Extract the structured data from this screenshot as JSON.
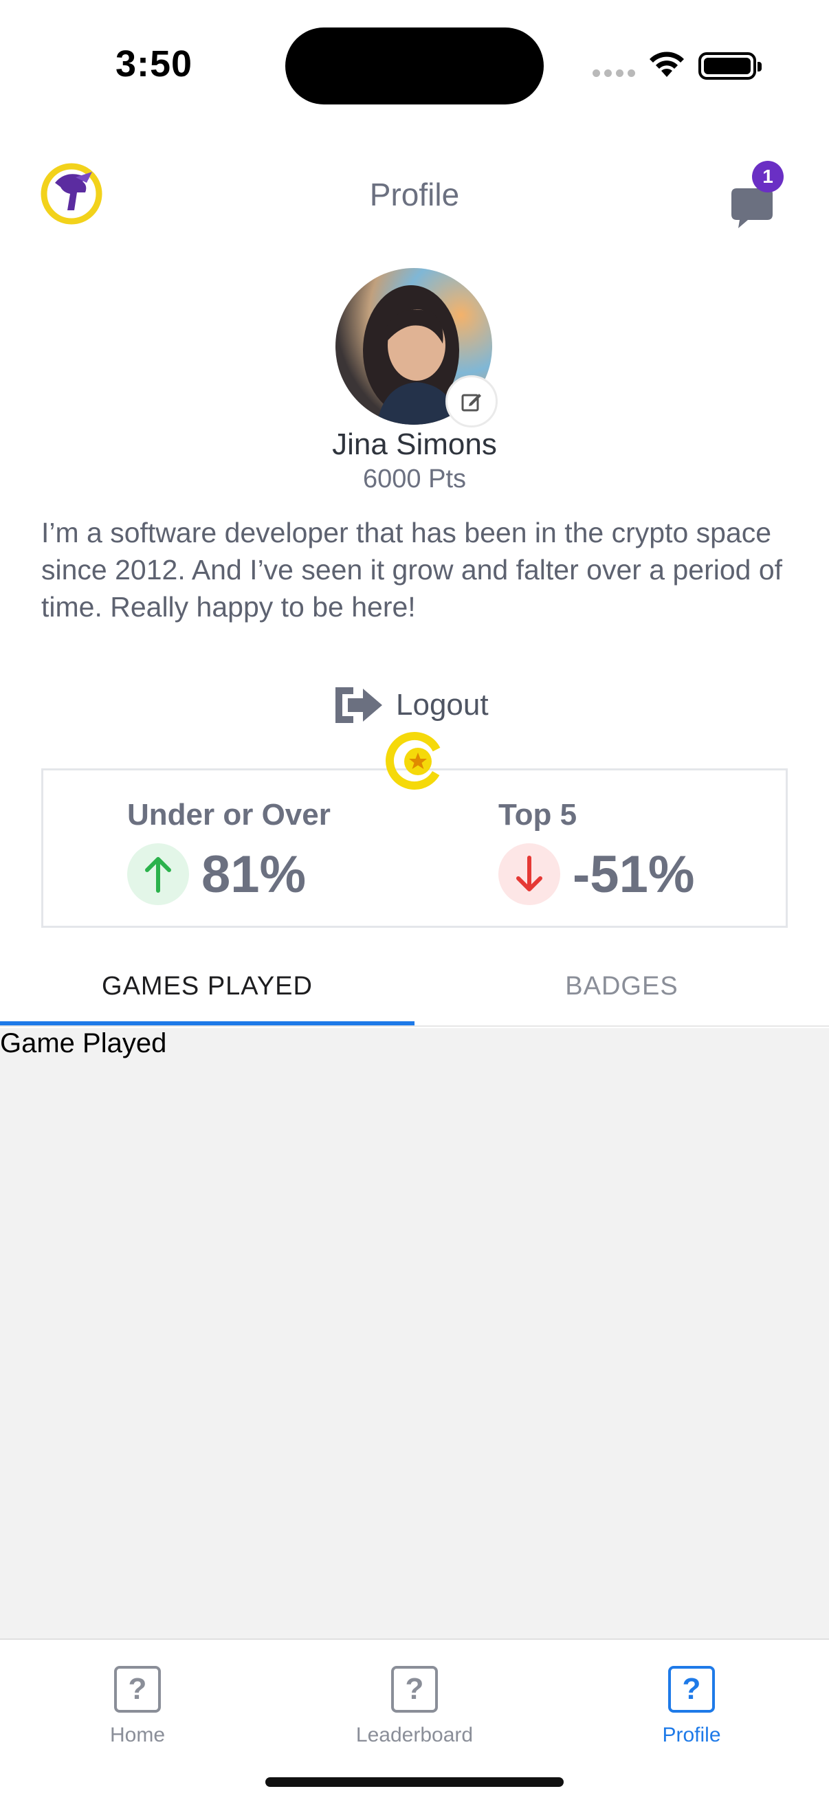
{
  "status_bar": {
    "time": "3:50"
  },
  "header": {
    "title": "Profile",
    "chat_badge_count": "1"
  },
  "profile": {
    "name": "Jina Simons",
    "points": "6000 Pts",
    "bio": "I’m a software developer that has been in the crypto space since 2012. And I’ve seen it grow and falter over a period of time. Really happy to be here!",
    "logout_label": "Logout"
  },
  "stats": [
    {
      "label": "Under or Over",
      "value": "81%",
      "trend": "up",
      "color": "#2bb24c",
      "bg": "#e3f6e8"
    },
    {
      "label": "Top 5",
      "value": "-51%",
      "trend": "down",
      "color": "#e53935",
      "bg": "#fde6e6"
    }
  ],
  "tabs": [
    {
      "label": "GAMES PLAYED",
      "active": true
    },
    {
      "label": "BADGES",
      "active": false
    }
  ],
  "content": {
    "label": "Game Played"
  },
  "bottom_nav": [
    {
      "label": "Home",
      "icon": "question-icon",
      "active": false
    },
    {
      "label": "Leaderboard",
      "icon": "question-icon",
      "active": false
    },
    {
      "label": "Profile",
      "icon": "question-icon",
      "active": true
    }
  ],
  "colors": {
    "accent": "#1e7ae8",
    "badge": "#6a2fc4",
    "brand_purple": "#5b2ca0",
    "brand_yellow": "#f2d21b"
  }
}
